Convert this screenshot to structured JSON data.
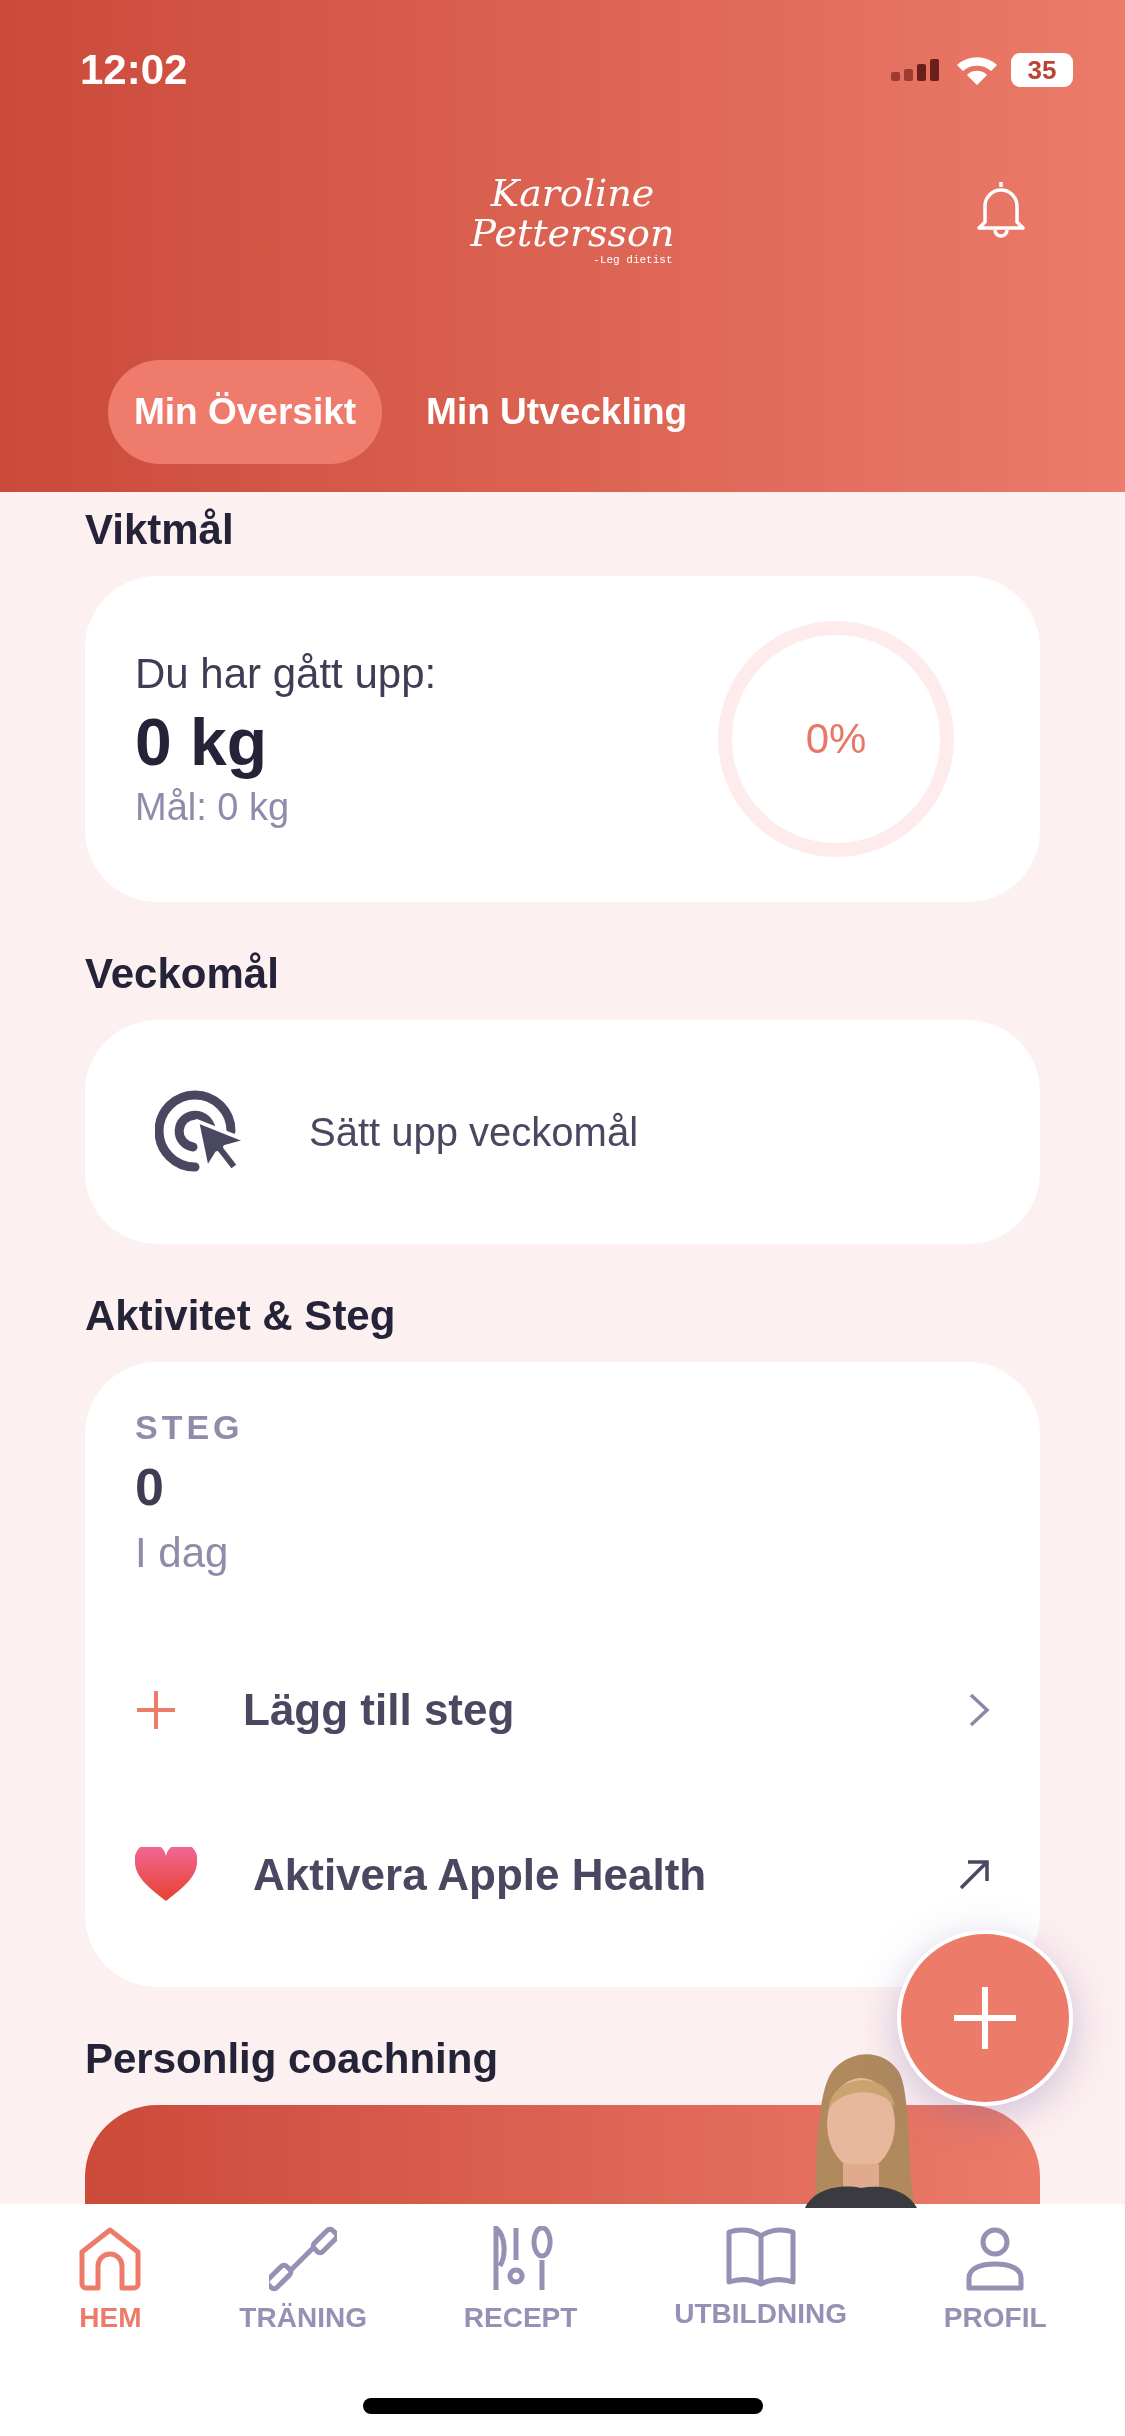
{
  "status_bar": {
    "time": "12:02",
    "battery": "35"
  },
  "header": {
    "logo_name": "Karoline Pettersson",
    "logo_subtitle": "-Leg dietist"
  },
  "tabs": [
    {
      "label": "Min Översikt",
      "selected": true
    },
    {
      "label": "Min Utveckling",
      "selected": false
    }
  ],
  "weight_goal": {
    "heading": "Viktmål",
    "label": "Du har gått upp:",
    "value": "0 kg",
    "goal": "Mål: 0 kg",
    "percent": "0%"
  },
  "week_goal": {
    "heading": "Veckomål",
    "action": "Sätt upp veckomål"
  },
  "activity": {
    "heading": "Aktivitet & Steg",
    "caption": "STEG",
    "steps": "0",
    "period": "I dag",
    "rows": [
      {
        "kind": "add",
        "label": "Lägg till steg"
      },
      {
        "kind": "health",
        "label": "Aktivera Apple Health"
      }
    ]
  },
  "coaching": {
    "heading": "Personlig coachning"
  },
  "nav": [
    {
      "kind": "home",
      "label": "HEM",
      "selected": true
    },
    {
      "kind": "training",
      "label": "TRÄNING",
      "selected": false
    },
    {
      "kind": "recipe",
      "label": "RECEPT",
      "selected": false
    },
    {
      "kind": "education",
      "label": "UTBILDNING",
      "selected": false
    },
    {
      "kind": "profile",
      "label": "PROFIL",
      "selected": false
    }
  ]
}
